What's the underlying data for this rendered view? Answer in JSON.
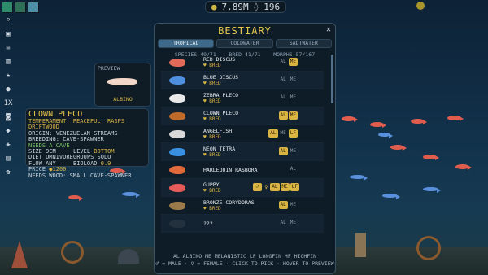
{
  "hud": {
    "coins": "7.89M",
    "fish_count": "196"
  },
  "colors": {
    "accent": "#e8c64d",
    "active_tab": "#3d6a8a",
    "badge_on": "#d9b443"
  },
  "toolbar": {
    "swatch_colors": [
      "#2d8c6c",
      "#2f6f58",
      "#4e8fa8"
    ],
    "icons": [
      "search-icon",
      "camera-icon",
      "clipboard-icon",
      "delete-icon",
      "star-icon",
      "light-icon",
      "speed-icon",
      "camera2-icon",
      "fish-icon",
      "move-icon",
      "decor-icon",
      "settings-icon"
    ],
    "speed_label": "1X"
  },
  "preview": {
    "label": "PREVIEW",
    "variant": "ALBINO"
  },
  "info": {
    "name": "CLOWN PLECO",
    "temperament_label": "TEMPERAMENT:",
    "temperament": "PEACEFUL; RASPS DRIFTWOOD",
    "origin_label": "ORIGIN:",
    "origin": "VENEZUELAN STREAMS",
    "breeding_label": "BREEDING:",
    "breeding": "CAVE-SPAWNER",
    "needs_cave": "NEEDS A CAVE",
    "size": "SIZE 9CM",
    "level_label": "LEVEL",
    "level": "BOTTOM",
    "diet": "DIET OMNIVORE",
    "groups": "GROUPS SOLO",
    "flow": "FLOW ANY",
    "bioload_label": "BIOLOAD",
    "bioload": "0.9",
    "price_label": "PRICE",
    "price": "1200",
    "needs_wood": "NEEDS WOOD: SMALL CAVE-SPAWNER"
  },
  "bestiary": {
    "title": "BESTIARY",
    "tabs": [
      "TROPICAL",
      "COLDWATER",
      "SALTWATER"
    ],
    "species": "SPECIES 49/71",
    "bred": "BRED 41/71",
    "morphs": "MORPHS 57/167",
    "rows": [
      {
        "name": "RED DISCUS",
        "bred": "♥ BRED",
        "badges": [
          {
            "t": "AL",
            "on": false
          },
          {
            "t": "ME",
            "on": true
          }
        ],
        "color": "#e36a5a"
      },
      {
        "name": "BLUE DISCUS",
        "bred": "♥ BRED",
        "badges": [
          {
            "t": "AL",
            "on": false
          },
          {
            "t": "ME",
            "on": false
          }
        ],
        "color": "#4e8fe0"
      },
      {
        "name": "ZEBRA PLECO",
        "bred": "♥ BRED",
        "badges": [
          {
            "t": "AL",
            "on": false
          },
          {
            "t": "ME",
            "on": false
          }
        ],
        "color": "#e8e8e8"
      },
      {
        "name": "CLOWN PLECO",
        "bred": "♥ BRED",
        "badges": [
          {
            "t": "AL",
            "on": true
          },
          {
            "t": "ME",
            "on": true
          }
        ],
        "color": "#c06a2a"
      },
      {
        "name": "ANGELFISH",
        "bred": "♥ BRED",
        "badges": [
          {
            "t": "AL",
            "on": true
          },
          {
            "t": "ME",
            "on": false
          },
          {
            "t": "LF",
            "on": true
          }
        ],
        "color": "#d8d8d8"
      },
      {
        "name": "NEON TETRA",
        "bred": "♥ BRED",
        "badges": [
          {
            "t": "AL",
            "on": true
          },
          {
            "t": "ME",
            "on": false
          }
        ],
        "color": "#3a8fe0"
      },
      {
        "name": "HARLEQUIN RASBORA",
        "bred": "",
        "badges": [
          {
            "t": "AL",
            "on": false
          }
        ],
        "color": "#e26a3a"
      },
      {
        "name": "GUPPY",
        "bred": "♥ BRED",
        "badges": [
          {
            "t": "AL",
            "on": true
          },
          {
            "t": "ME",
            "on": true
          },
          {
            "t": "LF",
            "on": true
          }
        ],
        "color": "#e85a5a"
      },
      {
        "name": "BRONZE CORYDORAS",
        "bred": "♥ BRED",
        "badges": [
          {
            "t": "AL",
            "on": true
          },
          {
            "t": "ME",
            "on": false
          }
        ],
        "color": "#9a7a4a"
      },
      {
        "name": "???",
        "bred": "",
        "badges": [
          {
            "t": "AL",
            "on": false
          },
          {
            "t": "ME",
            "on": false
          }
        ],
        "color": "#22313d"
      }
    ],
    "guppy_sex": {
      "male": "♂",
      "female": "♀"
    },
    "legend_line1": "AL ALBINO    ME MELANISTIC    LF LONGFIN    HF HIGHFIN",
    "legend_line2": "♂ = MALE · ♀ = FEMALE · CLICK TO PICK · HOVER TO PREVIEW"
  }
}
